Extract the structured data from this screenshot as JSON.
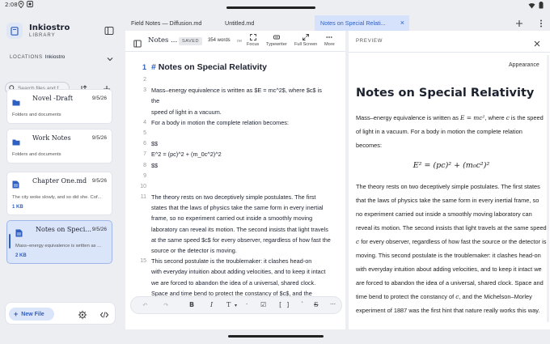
{
  "status": {
    "time": "2:08"
  },
  "sidebar": {
    "brand_title": "Inkiostro",
    "brand_sub": "LIBRARY",
    "locations_label": "LOCATIONS",
    "location_name": "Inkiostro",
    "search_placeholder": "Search files and f...",
    "items": [
      {
        "title": "Novel -Draft",
        "date": "9/5/26",
        "subtitle": "Folders and documents",
        "size": "",
        "icon": "folder-icon"
      },
      {
        "title": "Work Notes",
        "date": "9/5/26",
        "subtitle": "Folders and documents",
        "size": "",
        "icon": "folder-icon"
      },
      {
        "title": "Chapter One.md",
        "date": "9/5/26",
        "subtitle": "The city woke slowly, and so did she. Cof...",
        "size": "1 KB",
        "icon": "document-icon"
      },
      {
        "title": "Notes on Speci...",
        "date": "9/5/26",
        "subtitle": "Mass–energy equivalence is written as ...",
        "size": "2 KB",
        "icon": "document-icon",
        "active": true
      }
    ],
    "new_file_label": "New File"
  },
  "tabs": [
    {
      "label": "Field Notes — Diffusion.md",
      "active": false
    },
    {
      "label": "Untitled.md",
      "active": false
    },
    {
      "label": "Notes on Special Relati...",
      "active": true
    }
  ],
  "editor": {
    "title": "Notes ...",
    "saved_label": "SAVED",
    "word_count": "354 words",
    "tools": [
      "Focus",
      "Typewriter",
      "Full Screen",
      "More"
    ],
    "tool_cut": "ne",
    "lines": [
      {
        "n": "1",
        "text": "Notes on Special Relativity",
        "heading": true
      },
      {
        "n": "2",
        "text": ""
      },
      {
        "n": "3",
        "text": "Mass–energy equivalence is written as $E = mc^2$, where $c$ is"
      },
      {
        "n": "",
        "text": "the"
      },
      {
        "n": "",
        "text": "speed of light in a vacuum."
      },
      {
        "n": "4",
        "text": "For a body in motion the complete relation becomes:"
      },
      {
        "n": "5",
        "text": ""
      },
      {
        "n": "6",
        "text": "$$"
      },
      {
        "n": "7",
        "text": "E^2 = (pc)^2 + (m_0c^2)^2"
      },
      {
        "n": "8",
        "text": "$$"
      },
      {
        "n": "9",
        "text": ""
      },
      {
        "n": "10",
        "text": ""
      },
      {
        "n": "11",
        "text": "The theory rests on two deceptively simple postulates. The first"
      },
      {
        "n": "",
        "text": "states that the laws of physics take the same form in every inertial"
      },
      {
        "n": "",
        "text": "frame, so no experiment carried out inside a smoothly moving"
      },
      {
        "n": "",
        "text": "laboratory can reveal its motion. The second insists that light travels"
      },
      {
        "n": "",
        "text": "at the same speed $c$ for every observer, regardless of how fast the"
      },
      {
        "n": "",
        "text": "source or the detector is moving."
      },
      {
        "n": "15",
        "text": "This second postulate is the troublemaker: it clashes head-on"
      },
      {
        "n": "",
        "text": "with everyday intuition about adding velocities, and to keep it intact"
      },
      {
        "n": "",
        "text": "we are forced to abandon the idea of a universal, shared clock."
      },
      {
        "n": "",
        "text": "Space and time bend to protect the constancy of $c$, and the"
      }
    ]
  },
  "preview": {
    "header": "PREVIEW",
    "appearance_label": "Appearance",
    "title": "Notes on Special Relativity",
    "p1_a": "Mass–energy equivalence is written as ",
    "p1_math": "E = mc²",
    "p1_b": ", where ",
    "p1_c": "c",
    "p1_d": " is the speed of light in a vacuum. For a body in motion the complete relation becomes:",
    "equation": "E² = (pc)² + (m₀c²)²",
    "p2_a": "The theory rests on two deceptively simple postulates. The first states that the laws of physics take the same form in every inertial frame, so no experiment carried out inside a smoothly moving laboratory can reveal its motion. The second insists that light travels at the same speed ",
    "p2_c": "c",
    "p2_b": " for every observer, regardless of how fast the source or the detector is moving. This second postulate is the troublemaker: it clashes head-on with everyday intuition about adding velocities, and to keep it intact we are forced to abandon the idea of a universal, shared clock. Space and time bend to protect the constancy of ",
    "p2_c2": "c",
    "p2_d": ", and the Michelson–Morley experiment of 1887 was the first hint that nature really works this way."
  },
  "colors": {
    "accent": "#2f5fbf",
    "active_bg": "#dbe5fa",
    "background": "#eceef2"
  }
}
